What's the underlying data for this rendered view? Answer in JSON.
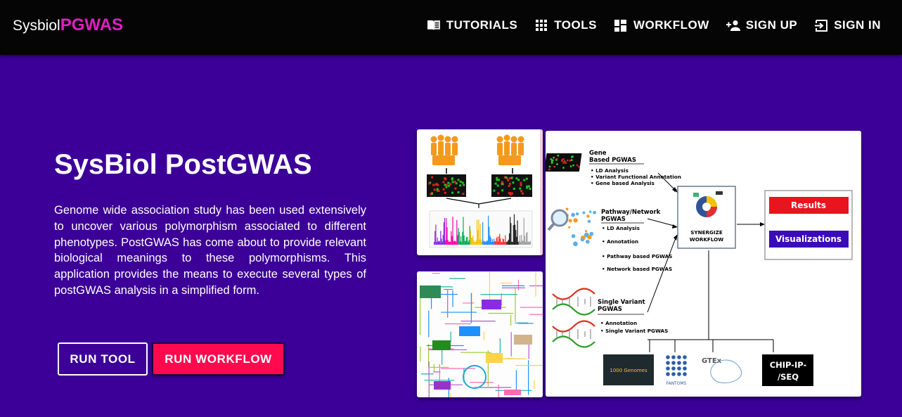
{
  "header": {
    "brand_prefix": "Sysbiol",
    "brand_suffix": "PGWAS",
    "nav": [
      {
        "label": "TUTORIALS",
        "icon": "book-icon"
      },
      {
        "label": "TOOLS",
        "icon": "grid-icon"
      },
      {
        "label": "WORKFLOW",
        "icon": "dashboard-icon"
      },
      {
        "label": "SIGN UP",
        "icon": "person-add-icon"
      },
      {
        "label": "SIGN IN",
        "icon": "login-icon"
      }
    ]
  },
  "hero": {
    "title": "SysBiol PostGWAS",
    "description": "Genome wide association study has been used extensively to uncover various polymorphism associated to different phenotypes. PostGWAS has come about to provide relevant biological meanings to these polymorphisms. This application provides the means to execute several types of postGWAS analysis in a simplified form.",
    "run_tool_label": "RUN TOOL",
    "run_workflow_label": "RUN WORKFLOW"
  },
  "workflow_figure": {
    "gene_heading": "Gene Based PGWAS",
    "gene_items": [
      "• LD Analysis",
      "• Variant Functional Annotation",
      "• Gene based Analysis"
    ],
    "pathway_heading": "Pathway/Network PGWAS",
    "pathway_items": [
      "• LD Analysis",
      "• Annotation",
      "• Pathway based PGWAS",
      "• Network based PGWAS"
    ],
    "single_heading": "Single Variant PGWAS",
    "single_items": [
      "• Annotation",
      "• Single Variant PGWAS"
    ],
    "synergize_label": "SYNERGIZE WORKFLOW",
    "results_label": "Results",
    "visualizations_label": "Visualizations",
    "resources": [
      "1000 Genomes",
      "FANTOM5",
      "GTEx",
      "CHIP-IP-/SEQ"
    ]
  },
  "colors": {
    "background": "#3c0099",
    "topbar": "#050505",
    "brand_accent": "#e020c0",
    "cta": "#ff0a4e"
  }
}
